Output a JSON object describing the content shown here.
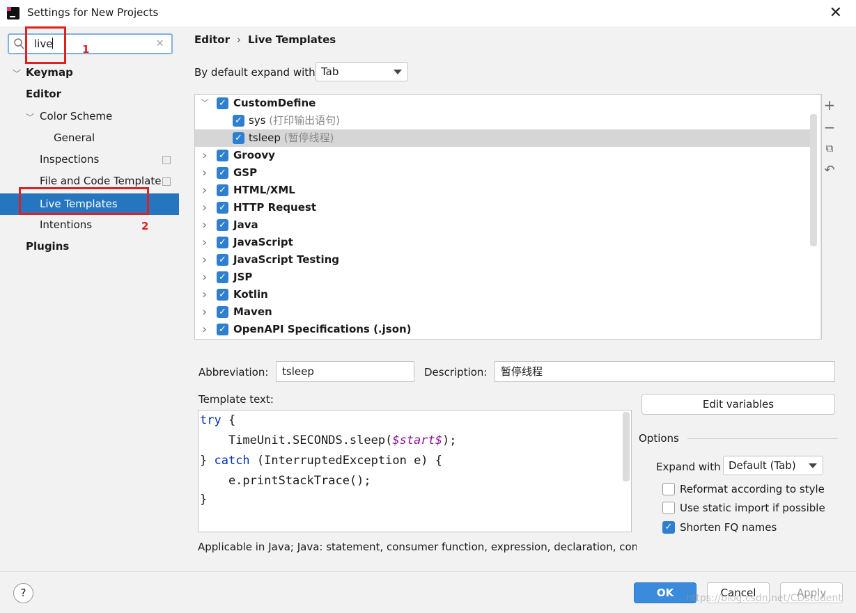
{
  "window": {
    "title": "Settings for New Projects"
  },
  "search": {
    "value": "live"
  },
  "annotations": {
    "num1": "1",
    "num2": "2"
  },
  "sidebar": {
    "keymap": "Keymap",
    "editor": "Editor",
    "color_scheme": "Color Scheme",
    "general": "General",
    "inspections": "Inspections",
    "file_and_code_template": "File and Code Template",
    "live_templates": "Live Templates",
    "intentions": "Intentions",
    "plugins": "Plugins"
  },
  "breadcrumb": {
    "parent": "Editor",
    "current": "Live Templates"
  },
  "expand": {
    "label": "By default expand with",
    "value": "Tab"
  },
  "template_groups": [
    {
      "name": "CustomDefine",
      "expanded": true,
      "checked": true,
      "children": [
        {
          "name": "sys",
          "desc": "(打印输出语句)",
          "checked": true
        },
        {
          "name": "tsleep",
          "desc": "(暂停线程)",
          "checked": true,
          "selected": true
        }
      ]
    },
    {
      "name": "Groovy",
      "checked": true
    },
    {
      "name": "GSP",
      "checked": true
    },
    {
      "name": "HTML/XML",
      "checked": true
    },
    {
      "name": "HTTP Request",
      "checked": true
    },
    {
      "name": "Java",
      "checked": true
    },
    {
      "name": "JavaScript",
      "checked": true
    },
    {
      "name": "JavaScript Testing",
      "checked": true
    },
    {
      "name": "JSP",
      "checked": true
    },
    {
      "name": "Kotlin",
      "checked": true
    },
    {
      "name": "Maven",
      "checked": true
    },
    {
      "name": "OpenAPI Specifications (.json)",
      "checked": true
    }
  ],
  "details": {
    "abbreviation_label": "Abbreviation:",
    "abbreviation_value": "tsleep",
    "description_label": "Description:",
    "description_value": "暂停线程",
    "template_text_label": "Template text:",
    "code": {
      "l1_kw": "try",
      "l1_rest": " {",
      "l2_pre": "    TimeUnit.SECONDS.sleep(",
      "l2_var": "$start$",
      "l2_post": ");",
      "l3_pre": "} ",
      "l3_kw": "catch",
      "l3_rest": " (InterruptedException e) {",
      "l4": "    e.printStackTrace();",
      "l5": "}"
    },
    "applicable": "Applicable in Java; Java: statement, consumer function, expression, declaration, comm"
  },
  "options": {
    "edit_variables": "Edit variables",
    "title": "Options",
    "expand_with_label": "Expand with",
    "expand_with_value": "Default (Tab)",
    "reformat": {
      "label": "Reformat according to style",
      "checked": false
    },
    "static_import": {
      "label": "Use static import if possible",
      "checked": false
    },
    "shorten_fq": {
      "label": "Shorten FQ names",
      "checked": true
    }
  },
  "footer": {
    "help": "?",
    "ok": "OK",
    "cancel": "Cancel",
    "apply": "Apply",
    "watermark": "https://blog.csdn.net/CDstudent"
  }
}
